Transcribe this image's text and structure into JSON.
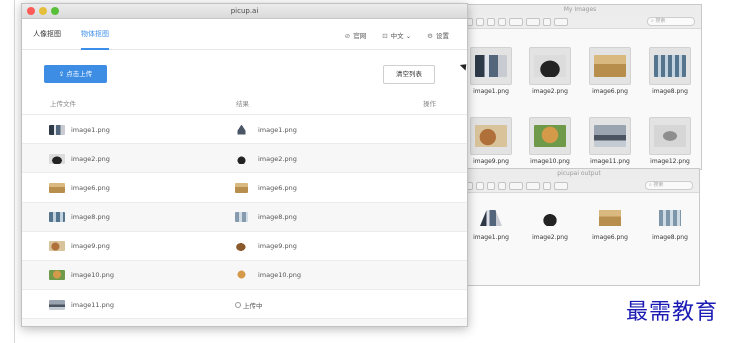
{
  "main_window": {
    "title": "picup.ai",
    "tabs": [
      {
        "label": "人像抠图",
        "active": false
      },
      {
        "label": "物体抠图",
        "active": true
      }
    ],
    "nav_links": {
      "website": "官网",
      "language": "中文",
      "settings": "设置"
    },
    "upload_button": "点击上传",
    "clear_button": "清空列表",
    "columns": {
      "uploaded": "上传文件",
      "result": "结果",
      "action": "操作"
    },
    "rows": [
      {
        "file": "image1.png",
        "result": "image1.png",
        "thumb": "p-jacket"
      },
      {
        "file": "image2.png",
        "result": "image2.png",
        "thumb": "p-bag"
      },
      {
        "file": "image6.png",
        "result": "image6.png",
        "thumb": "p-box"
      },
      {
        "file": "image8.png",
        "result": "image8.png",
        "thumb": "p-chairs"
      },
      {
        "file": "image9.png",
        "result": "image9.png",
        "thumb": "p-dog"
      },
      {
        "file": "image10.png",
        "result": "image10.png",
        "thumb": "p-retriever"
      },
      {
        "file": "image11.png",
        "result": "上传中",
        "thumb": "p-car"
      }
    ]
  },
  "finder_images": {
    "title": "My Images",
    "search_placeholder": "搜索",
    "files": [
      "image1.png",
      "image2.png",
      "image6.png",
      "image8.png",
      "image9.png",
      "image10.png",
      "image11.png",
      "image12.png"
    ]
  },
  "finder_output": {
    "title": "picupai output",
    "search_placeholder": "搜索",
    "files": [
      "image1.png",
      "image2.png",
      "image6.png",
      "image8.png"
    ]
  },
  "watermark": "最需教育",
  "colors": {
    "accent": "#3b8eea",
    "upload_button": "#3d8de5",
    "watermark": "#1c1cb4"
  }
}
